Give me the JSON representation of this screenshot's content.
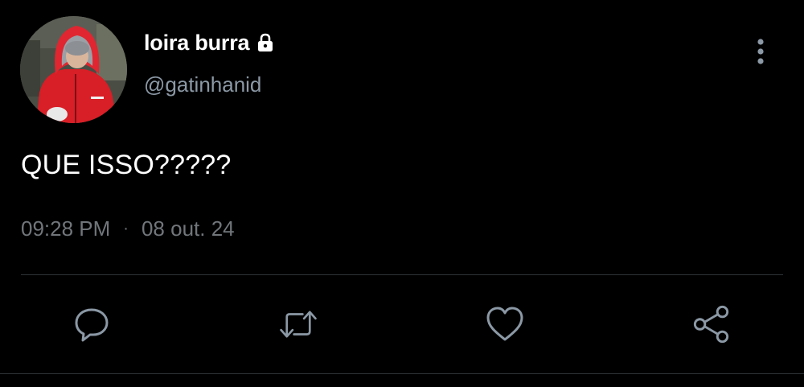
{
  "user": {
    "display_name": "loira burra",
    "handle": "@gatinhanid",
    "protected_icon": "lock-icon",
    "avatar": "profile-photo-red-hooded-jacket"
  },
  "tweet": {
    "text": "QUE ISSO?????",
    "time": "09:28 PM",
    "separator": "·",
    "date": "08 out. 24"
  },
  "menu": {
    "icon": "more-vertical-icon"
  },
  "actions": [
    {
      "name": "reply",
      "icon": "reply-icon"
    },
    {
      "name": "retweet",
      "icon": "retweet-icon"
    },
    {
      "name": "like",
      "icon": "heart-icon"
    },
    {
      "name": "share",
      "icon": "share-icon"
    }
  ],
  "colors": {
    "background": "#000000",
    "primary_text": "#ffffff",
    "secondary_text": "#71767b",
    "icon": "#8b98a5",
    "divider": "#2f3336"
  }
}
